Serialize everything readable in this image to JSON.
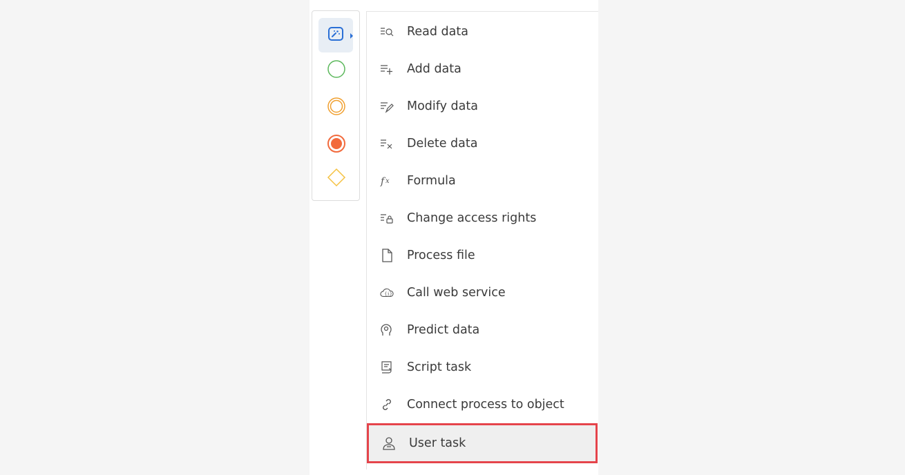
{
  "palette": {
    "tools": [
      {
        "name": "toolbox-icon",
        "active": true
      },
      {
        "name": "start-event-icon",
        "color": "#5cb85c"
      },
      {
        "name": "intermediate-event-icon",
        "color": "#f0a030"
      },
      {
        "name": "end-event-icon",
        "color": "#f26a3c"
      },
      {
        "name": "gateway-icon",
        "color": "#f5c242"
      }
    ]
  },
  "menu": {
    "items": [
      {
        "label": "Read data",
        "icon": "read-data-icon"
      },
      {
        "label": "Add data",
        "icon": "add-data-icon"
      },
      {
        "label": "Modify data",
        "icon": "modify-data-icon"
      },
      {
        "label": "Delete data",
        "icon": "delete-data-icon"
      },
      {
        "label": "Formula",
        "icon": "formula-icon"
      },
      {
        "label": "Change access rights",
        "icon": "access-rights-icon"
      },
      {
        "label": "Process file",
        "icon": "file-icon"
      },
      {
        "label": "Call web service",
        "icon": "web-service-icon"
      },
      {
        "label": "Predict data",
        "icon": "predict-data-icon"
      },
      {
        "label": "Script task",
        "icon": "script-task-icon"
      },
      {
        "label": "Connect process to object",
        "icon": "link-icon"
      },
      {
        "label": "User task",
        "icon": "user-task-icon",
        "highlighted": true
      }
    ]
  },
  "colors": {
    "accent": "#2a6fd6",
    "highlight_border": "#e5444b"
  }
}
